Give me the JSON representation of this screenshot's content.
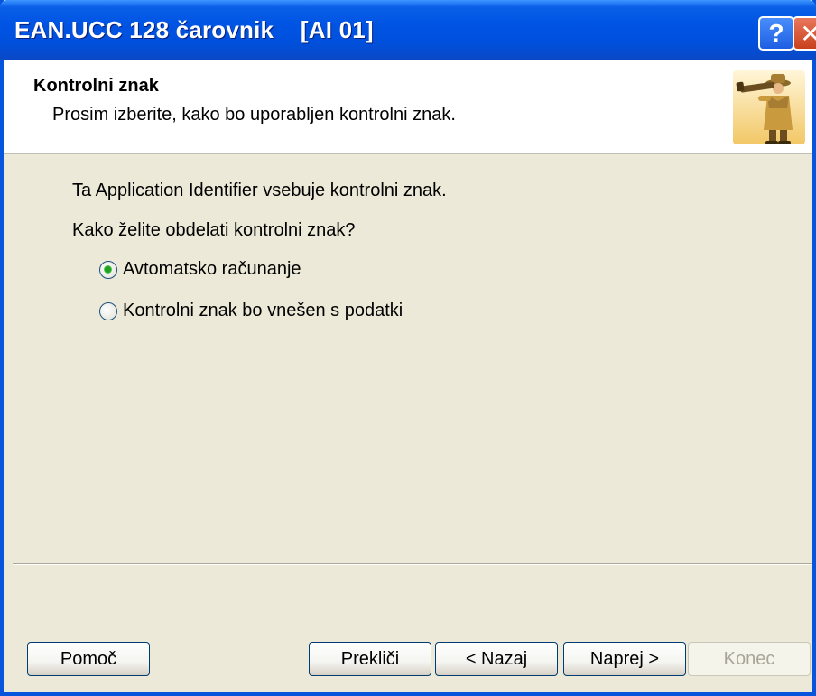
{
  "window": {
    "title": "EAN.UCC 128 čarovnik    [AI 01]",
    "help_button": "?",
    "close_button": "✕"
  },
  "header": {
    "title": "Kontrolni znak",
    "subtitle": "Prosim izberite, kako bo uporabljen kontrolni znak."
  },
  "content": {
    "info_text": "Ta Application Identifier vsebuje kontrolni znak.",
    "question": "Kako želite obdelati kontrolni znak?",
    "options": [
      {
        "label": "Avtomatsko računanje",
        "checked": true
      },
      {
        "label": "Kontrolni znak bo vnešen s podatki",
        "checked": false
      }
    ]
  },
  "buttons": {
    "help": "Pomoč",
    "cancel": "Prekliči",
    "back": "< Nazaj",
    "next": "Naprej >",
    "finish": "Konec"
  },
  "icons": {
    "wizard": "wizard-figure-icon",
    "help": "help-icon",
    "close": "close-icon"
  },
  "colors": {
    "titlebar": "#0054e3",
    "background": "#ece9d8",
    "radio_dot": "#21a121"
  }
}
